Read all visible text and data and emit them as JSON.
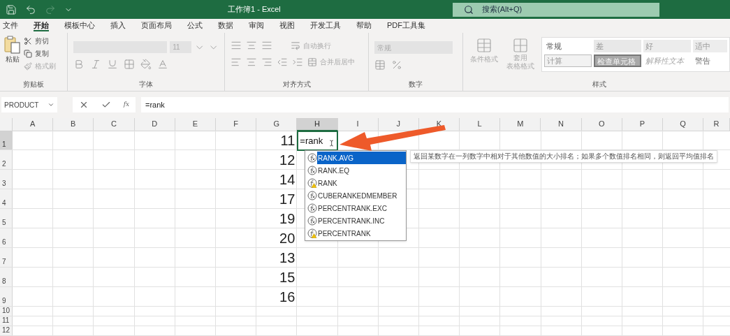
{
  "title_bar": {
    "title": "工作簿1  -  Excel",
    "search_placeholder": "搜索(Alt+Q)"
  },
  "menu_tabs": [
    {
      "label": "文件",
      "selected": false
    },
    {
      "label": "开始",
      "selected": true
    },
    {
      "label": "模板中心",
      "selected": false
    },
    {
      "label": "插入",
      "selected": false
    },
    {
      "label": "页面布局",
      "selected": false
    },
    {
      "label": "公式",
      "selected": false
    },
    {
      "label": "数据",
      "selected": false
    },
    {
      "label": "审阅",
      "selected": false
    },
    {
      "label": "视图",
      "selected": false
    },
    {
      "label": "开发工具",
      "selected": false
    },
    {
      "label": "帮助",
      "selected": false
    },
    {
      "label": "PDF工具集",
      "selected": false
    }
  ],
  "ribbon": {
    "clipboard": {
      "paste": "粘贴",
      "cut": "剪切",
      "copy": "复制",
      "format_painter": "格式刷",
      "label": "剪贴板"
    },
    "font": {
      "size": "11",
      "label": "字体"
    },
    "alignment": {
      "wrap_text": "自动换行",
      "merge": "合并后居中",
      "label": "对齐方式"
    },
    "number": {
      "format": "常规",
      "label": "数字"
    },
    "styles": {
      "conditional": "条件格式",
      "table_format_line1": "套用",
      "table_format_line2": "表格格式",
      "label": "样式",
      "cell_styles": [
        {
          "label": "常规",
          "kind": "normal"
        },
        {
          "label": "差",
          "kind": "bad"
        },
        {
          "label": "好",
          "kind": "good"
        },
        {
          "label": "适中",
          "kind": "neutral"
        },
        {
          "label": "计算",
          "kind": "calc"
        },
        {
          "label": "检查单元格",
          "kind": "check"
        },
        {
          "label": "解释性文本",
          "kind": "explanatory"
        },
        {
          "label": "警告",
          "kind": "warning"
        }
      ]
    }
  },
  "formula_bar": {
    "name_box": "PRODUCT",
    "function_button": "fx",
    "formula": "=rank"
  },
  "sheet": {
    "columns": [
      {
        "label": "A",
        "selected": false
      },
      {
        "label": "B",
        "selected": false
      },
      {
        "label": "C",
        "selected": false
      },
      {
        "label": "D",
        "selected": false
      },
      {
        "label": "E",
        "selected": false
      },
      {
        "label": "F",
        "selected": false
      },
      {
        "label": "G",
        "selected": false
      },
      {
        "label": "H",
        "selected": true
      },
      {
        "label": "I",
        "selected": false
      },
      {
        "label": "J",
        "selected": false
      },
      {
        "label": "K",
        "selected": false
      },
      {
        "label": "L",
        "selected": false
      },
      {
        "label": "M",
        "selected": false
      },
      {
        "label": "N",
        "selected": false
      },
      {
        "label": "O",
        "selected": false
      },
      {
        "label": "P",
        "selected": false
      },
      {
        "label": "Q",
        "selected": false
      },
      {
        "label": "R",
        "selected": false
      }
    ],
    "rows": [
      {
        "label": "1",
        "selected": true
      },
      {
        "label": "2",
        "selected": false
      },
      {
        "label": "3",
        "selected": false
      },
      {
        "label": "4",
        "selected": false
      },
      {
        "label": "5",
        "selected": false
      },
      {
        "label": "6",
        "selected": false
      },
      {
        "label": "7",
        "selected": false
      },
      {
        "label": "8",
        "selected": false
      },
      {
        "label": "9",
        "selected": false
      },
      {
        "label": "10",
        "selected": false
      },
      {
        "label": "11",
        "selected": false
      },
      {
        "label": "12",
        "selected": false
      }
    ],
    "column_g_values": [
      "11",
      "12",
      "14",
      "17",
      "19",
      "20",
      "13",
      "15",
      "16"
    ],
    "active_cell_value": "=rank"
  },
  "autocomplete": {
    "items": [
      {
        "label": "RANK.AVG",
        "kind": "function",
        "selected": true
      },
      {
        "label": "RANK.EQ",
        "kind": "function",
        "selected": false
      },
      {
        "label": "RANK",
        "kind": "compat",
        "selected": false
      },
      {
        "label": "CUBERANKEDMEMBER",
        "kind": "function",
        "selected": false
      },
      {
        "label": "PERCENTRANK.EXC",
        "kind": "function",
        "selected": false
      },
      {
        "label": "PERCENTRANK.INC",
        "kind": "function",
        "selected": false
      },
      {
        "label": "PERCENTRANK",
        "kind": "compat",
        "selected": false
      }
    ],
    "tooltip": "返回某数字在一列数字中相对于其他数值的大小排名；如果多个数值排名相同，则返回平均值排名"
  }
}
